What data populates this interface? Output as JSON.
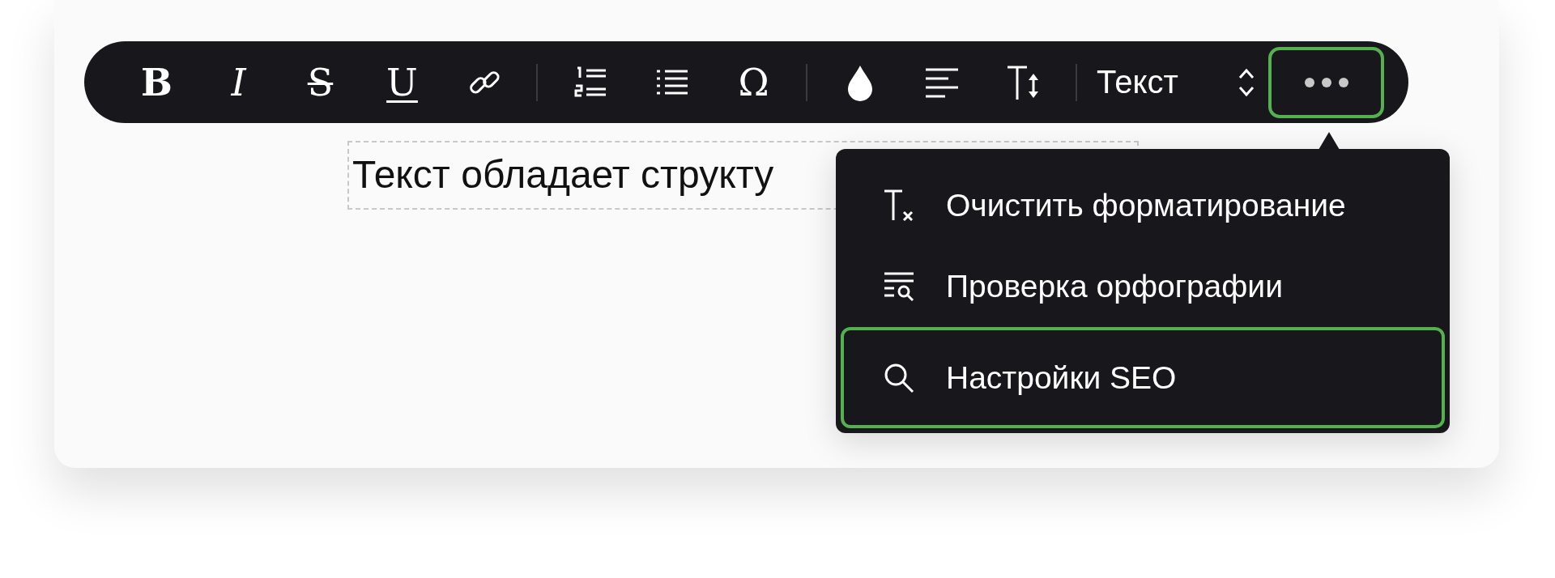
{
  "toolbar": {
    "items": [
      {
        "kind": "bold",
        "label": "B"
      },
      {
        "kind": "italic",
        "label": "I"
      },
      {
        "kind": "strike",
        "label": "S"
      },
      {
        "kind": "underline",
        "label": "U"
      },
      {
        "kind": "link"
      },
      {
        "kind": "divider"
      },
      {
        "kind": "numbered"
      },
      {
        "kind": "bulleted"
      },
      {
        "kind": "symbol",
        "label": "Ω"
      },
      {
        "kind": "divider"
      },
      {
        "kind": "color"
      },
      {
        "kind": "align"
      },
      {
        "kind": "size"
      },
      {
        "kind": "divider"
      },
      {
        "kind": "select",
        "value": "Текст"
      },
      {
        "kind": "more",
        "highlighted": true
      }
    ]
  },
  "editor": {
    "text": "Текст обладает структу"
  },
  "menu": {
    "items": [
      {
        "kind": "clear",
        "label": "Очистить форматирование",
        "selected": false
      },
      {
        "kind": "spell",
        "label": "Проверка орфографии",
        "selected": false
      },
      {
        "kind": "search",
        "label": "Настройки SEO",
        "selected": true
      }
    ]
  }
}
